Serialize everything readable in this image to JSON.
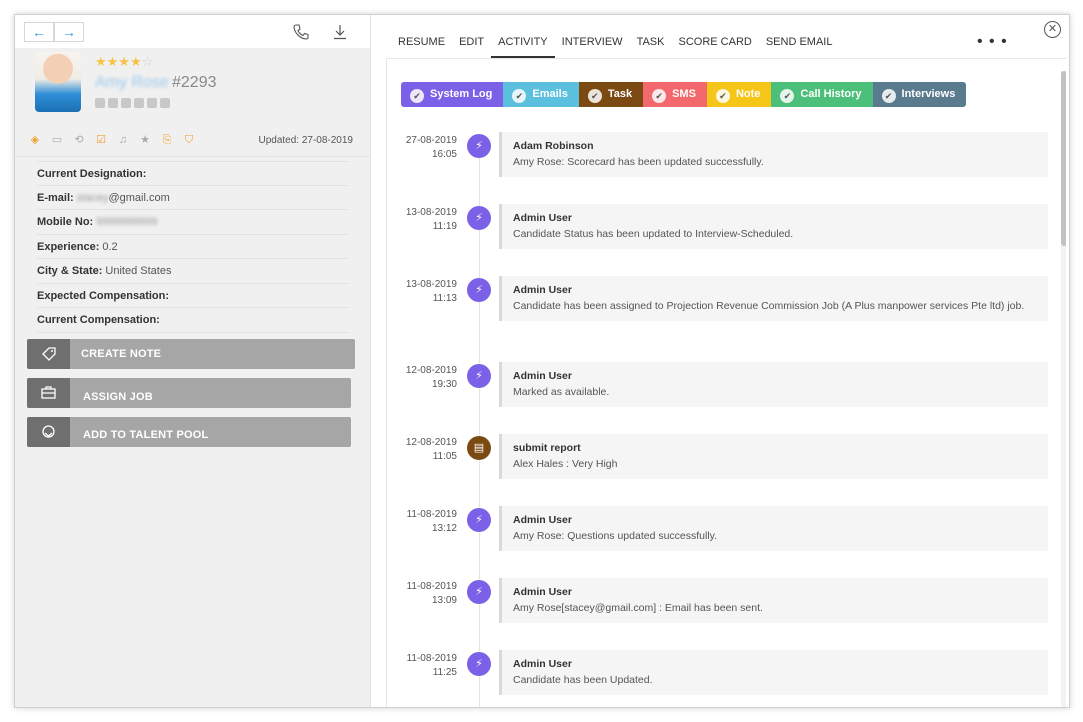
{
  "profile": {
    "rating_stars_filled": "★★★★",
    "rating_stars_empty": "☆",
    "name": "Amy Rose",
    "id": "#2293",
    "updated_label": "Updated:",
    "updated_date": "27-08-2019"
  },
  "details": [
    {
      "label": "Current Designation:",
      "value": ""
    },
    {
      "label": "E-mail:",
      "value_hidden": "stacey",
      "value": "@gmail.com"
    },
    {
      "label": "Mobile No:",
      "value_hidden": "9999999999",
      "value": ""
    },
    {
      "label": "Experience:",
      "value": "0.2"
    },
    {
      "label": "City & State:",
      "value": "United States"
    },
    {
      "label": "Expected Compensation:",
      "value": ""
    },
    {
      "label": "Current Compensation:",
      "value": ""
    }
  ],
  "actions": {
    "create_note": "CREATE NOTE",
    "assign_job": "ASSIGN JOB",
    "add_to_talent_pool": "ADD TO TALENT POOL"
  },
  "tabs": [
    "RESUME",
    "EDIT",
    "ACTIVITY",
    "INTERVIEW",
    "TASK",
    "SCORE CARD",
    "SEND EMAIL"
  ],
  "more": "• • •",
  "close": "✕",
  "filters": [
    {
      "label": "System Log",
      "color": "#7b61e8"
    },
    {
      "label": "Emails",
      "color": "#5bc0de"
    },
    {
      "label": "Task",
      "color": "#7b4a12"
    },
    {
      "label": "SMS",
      "color": "#f2686c"
    },
    {
      "label": "Note",
      "color": "#f5c518"
    },
    {
      "label": "Call History",
      "color": "#4cc07a"
    },
    {
      "label": "Interviews",
      "color": "#5a7a8e"
    }
  ],
  "timeline": [
    {
      "date": "27-08-2019",
      "time": "16:05",
      "title": "Adam Robinson",
      "message": "Amy Rose: Scorecard has been updated successfully.",
      "kind": "system"
    },
    {
      "date": "13-08-2019",
      "time": "11:19",
      "title": "Admin User",
      "message": "Candidate Status has been updated to Interview-Scheduled.",
      "kind": "system"
    },
    {
      "date": "13-08-2019",
      "time": "11:13",
      "title": "Admin User",
      "message": "Candidate has been assigned to Projection Revenue Commission Job (A Plus manpower services Pte ltd) job.",
      "kind": "system"
    },
    {
      "date": "12-08-2019",
      "time": "19:30",
      "title": "Admin User",
      "message": "Marked as available.",
      "kind": "system"
    },
    {
      "date": "12-08-2019",
      "time": "11:05",
      "title": "submit report",
      "message": "Alex Hales : Very High",
      "kind": "task"
    },
    {
      "date": "11-08-2019",
      "time": "13:12",
      "title": "Admin User",
      "message": "Amy Rose: Questions updated successfully.",
      "kind": "system"
    },
    {
      "date": "11-08-2019",
      "time": "13:09",
      "title": "Admin User",
      "message": "Amy Rose[stacey@gmail.com] : Email has been sent.",
      "kind": "system"
    },
    {
      "date": "11-08-2019",
      "time": "11:25",
      "title": "Admin User",
      "message": "Candidate has been Updated.",
      "kind": "system"
    }
  ],
  "colors": {
    "system": "#7b61e8",
    "task": "#7b4a12",
    "nav_accent": "#2a9fe0",
    "tool_accent": "#f0a030"
  }
}
